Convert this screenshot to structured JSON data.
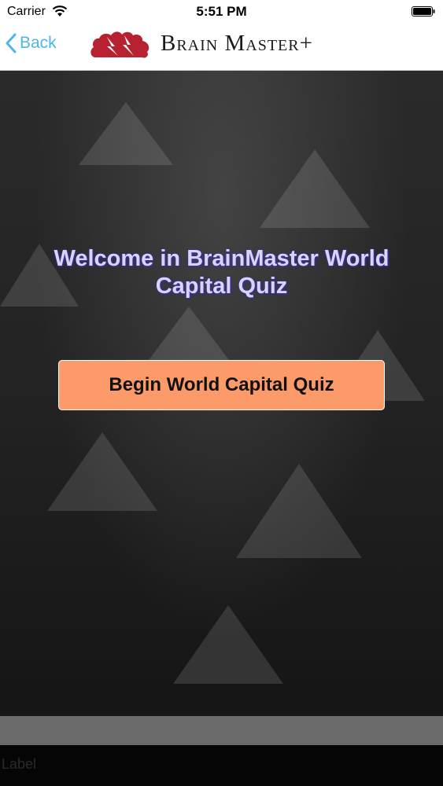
{
  "status_bar": {
    "carrier": "Carrier",
    "time": "5:51 PM"
  },
  "nav": {
    "back_label": "Back",
    "brand": "Brain Master+",
    "logo_icon": "brain-logo-icon",
    "colors": {
      "back": "#4fb6e8",
      "logo": "#b82230"
    }
  },
  "main": {
    "welcome_line1": "Welcome in BrainMaster World",
    "welcome_line2": "Capital Quiz",
    "begin_button": "Begin World Capital Quiz",
    "colors": {
      "button": "#fc9a6a",
      "welcome_text": "#d8d4f8"
    }
  },
  "footer": {
    "label": "Label"
  }
}
